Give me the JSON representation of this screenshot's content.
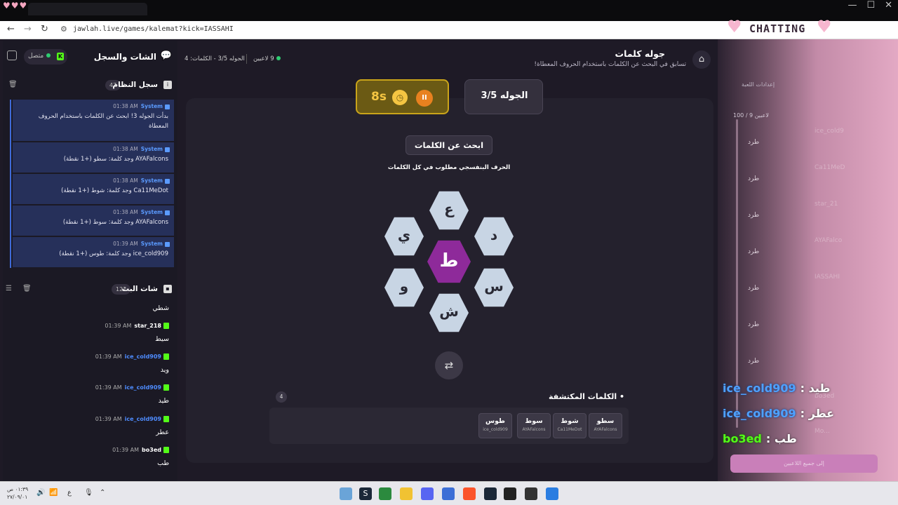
{
  "browser": {
    "url": "jawlah.live/games/kalemat?kick=IASSAHI"
  },
  "left_panel": {
    "title": "الشات والسجل",
    "status": "متصل",
    "system_log": {
      "title": "سجل النظام",
      "count": "47",
      "entries": [
        {
          "time": "01:38 AM",
          "sender": "System",
          "text": "بدأت الجوله 3! ابحث عن الكلمات باستخدام الحروف المعطاة"
        },
        {
          "time": "01:38 AM",
          "sender": "System",
          "text": "AYAFalcons وجد كلمة: سطو (+1 نقطة)"
        },
        {
          "time": "01:38 AM",
          "sender": "System",
          "text": "Ca11MeDot وجد كلمة: شوط (+1 نقطة)"
        },
        {
          "time": "01:38 AM",
          "sender": "System",
          "text": "AYAFalcons وجد كلمة: سوط (+1 نقطة)"
        },
        {
          "time": "01:39 AM",
          "sender": "System",
          "text": "ice_cold909 وجد كلمة: طوس (+1 نقطة)"
        }
      ]
    },
    "stream_chat": {
      "title": "شات البث",
      "count": "121",
      "top_msg": "شطي",
      "messages": [
        {
          "time": "01:39 AM",
          "user": "star_218",
          "user_color": "#ffffff",
          "text": "سيط"
        },
        {
          "time": "01:39 AM",
          "user": "ice_cold909",
          "user_color": "#4e8cff",
          "text": "ويد"
        },
        {
          "time": "01:39 AM",
          "user": "ice_cold909",
          "user_color": "#4e8cff",
          "text": "طيد"
        },
        {
          "time": "01:39 AM",
          "user": "ice_cold909",
          "user_color": "#4e8cff",
          "text": "عطر"
        },
        {
          "time": "01:39 AM",
          "user": "bo3ed",
          "user_color": "#ffffff",
          "text": "طب"
        }
      ]
    }
  },
  "header": {
    "title": "جوله كلمات",
    "subtitle": "تسابق في البحث عن الكلمات باستخدام الحروف المعطاة!",
    "players": "9 لاعبين",
    "round_info": "الجوله 3/5 - الكلمات: 4"
  },
  "game": {
    "timer": "8s",
    "round": "الجوله 3/5",
    "find_label": "ابحث عن الكلمات",
    "hint": "الحرف البنفسجي مطلوب في كل الكلمات",
    "letters": {
      "top": "ع",
      "top_right": "د",
      "bottom_right": "س",
      "bottom": "ش",
      "bottom_left": "و",
      "top_left": "ي",
      "center": "ط"
    },
    "found_title": "الكلمات المكتشفة",
    "found_count": "4",
    "found_words": [
      {
        "word": "سطو",
        "user": "AYAFalcons"
      },
      {
        "word": "شوط",
        "user": "Ca11MeDot"
      },
      {
        "word": "سوط",
        "user": "AYAFalcons"
      },
      {
        "word": "طوس",
        "user": "ice_cold909"
      }
    ]
  },
  "right_panel": {
    "tab_settings": "إعدادات اللعبة",
    "player_count": "100 / 9 لاعبين",
    "kick_label": "طرد",
    "names": [
      "ice_cold9",
      "Ca11MeD",
      "star_21",
      "AYAFalco",
      "IASSAHI",
      "",
      "",
      "bo3ed",
      "Mo..."
    ],
    "all_players_btn": "إلى جميع اللاعبين"
  },
  "overlay": {
    "chatting_label": "CHATTING",
    "lines": [
      {
        "user": "ice_cold909",
        "msg": ": طيد",
        "color": "#4ea1ff"
      },
      {
        "user": "ice_cold909",
        "msg": ": عطر",
        "color": "#4ea1ff"
      },
      {
        "user": "bo3ed",
        "msg": ": طب",
        "color": "#53fc18"
      }
    ]
  },
  "taskbar": {
    "time": "٠١:٣٩ ص",
    "date": "٢٧/٠٩/٠١"
  }
}
